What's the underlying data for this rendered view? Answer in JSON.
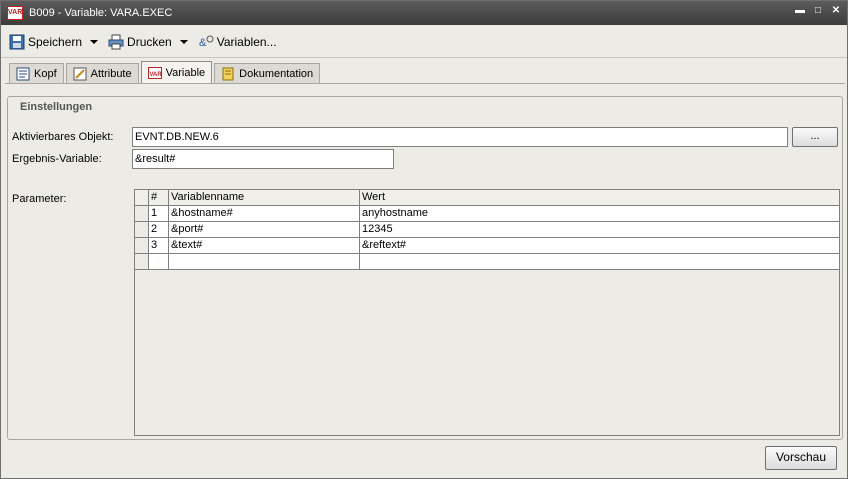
{
  "window": {
    "title": "B009 - Variable: VARA.EXEC",
    "icon_text": "VAR",
    "controls": [
      "minimize-icon",
      "maximize-icon",
      "close-icon"
    ]
  },
  "toolbar": {
    "save_label": "Speichern",
    "print_label": "Drucken",
    "variables_label": "Variablen..."
  },
  "tabs": [
    {
      "label": "Kopf",
      "icon": "header-icon"
    },
    {
      "label": "Attribute",
      "icon": "attributes-icon"
    },
    {
      "label": "Variable",
      "icon": "var-icon",
      "active": true
    },
    {
      "label": "Dokumentation",
      "icon": "doc-icon"
    }
  ],
  "settings": {
    "group_title": "Einstellungen",
    "object_label": "Aktivierbares Objekt:",
    "object_value": "EVNT.DB.NEW.6",
    "browse_label": "...",
    "result_label": "Ergebnis-Variable:",
    "result_value": "&result#",
    "params_label": "Parameter:"
  },
  "params_table": {
    "headers": {
      "num": "#",
      "name": "Variablenname",
      "value": "Wert"
    },
    "rows": [
      {
        "num": "1",
        "name": "&hostname#",
        "value": "anyhostname"
      },
      {
        "num": "2",
        "name": "&port#",
        "value": "12345"
      },
      {
        "num": "3",
        "name": "&text#",
        "value": "&reftext#"
      },
      {
        "num": "",
        "name": "",
        "value": ""
      }
    ]
  },
  "footer": {
    "preview_label": "Vorschau"
  }
}
